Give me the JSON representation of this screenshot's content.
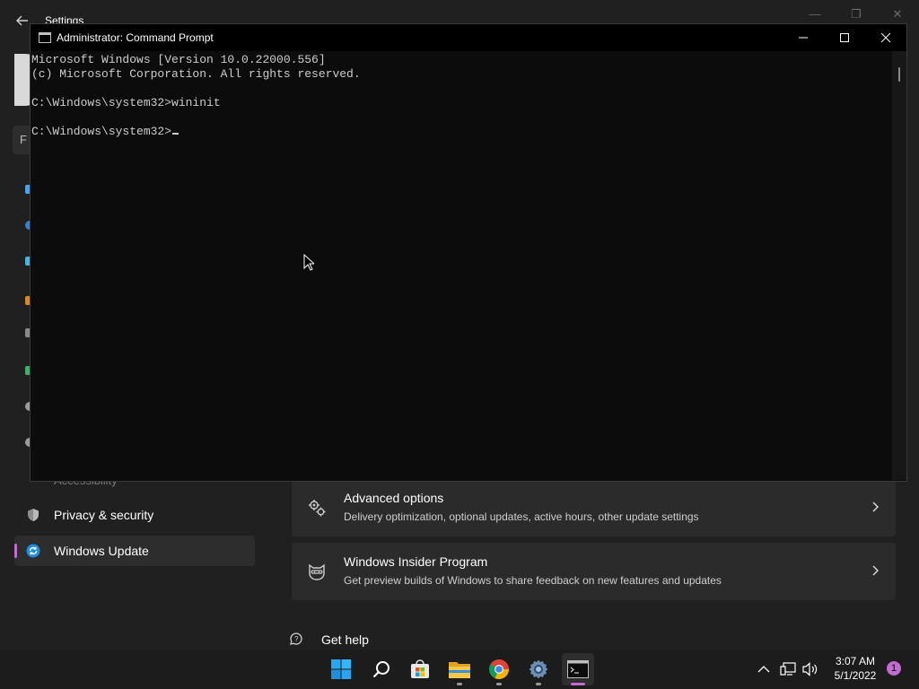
{
  "settings": {
    "window_title": "Settings",
    "search_partial": "F",
    "hidden_nav_label": "Accessibility",
    "nav": [
      {
        "label": "Privacy & security",
        "icon": "shield-icon"
      },
      {
        "label": "Windows Update",
        "icon": "windows-update-icon",
        "active": true
      }
    ],
    "cards": [
      {
        "title": "Advanced options",
        "subtitle": "Delivery optimization, optional updates, active hours, other update settings",
        "icon": "gears-icon"
      },
      {
        "title": "Windows Insider Program",
        "subtitle": "Get preview builds of Windows to share feedback on new features and updates",
        "icon": "ninja-cat-icon"
      }
    ],
    "get_help": "Get help"
  },
  "cmd": {
    "title": "Administrator: Command Prompt",
    "lines": [
      "Microsoft Windows [Version 10.0.22000.556]",
      "(c) Microsoft Corporation. All rights reserved.",
      "",
      "C:\\Windows\\system32>wininit",
      "",
      "C:\\Windows\\system32>"
    ]
  },
  "taskbar": {
    "apps": [
      "windows-start-icon",
      "search-icon",
      "microsoft-store-icon",
      "file-explorer-icon",
      "chrome-icon",
      "settings-icon",
      "terminal-icon"
    ],
    "time": "3:07 AM",
    "date": "5/1/2022",
    "notification_count": "1"
  },
  "colors": {
    "accent": "#c36bd1",
    "console_bg": "#0c0c0c",
    "settings_bg": "#202020"
  }
}
